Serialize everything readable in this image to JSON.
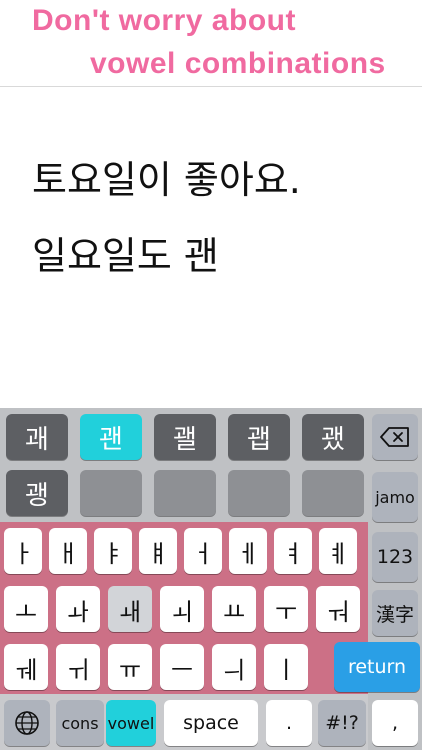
{
  "banner": {
    "line1": "Don't worry about",
    "line2": "vowel combinations",
    "color": "#f06aa0"
  },
  "editor": {
    "lines": [
      "토요일이 좋아요.",
      "일요일도 괜"
    ]
  },
  "keyboard": {
    "candidates_row1": [
      "괘",
      "괜",
      "괠",
      "괩",
      "괬"
    ],
    "candidates_row2": [
      "괭",
      "",
      "",
      "",
      ""
    ],
    "selected_candidate": "괜",
    "vowel_rows": [
      [
        "ㅏ",
        "ㅐ",
        "ㅑ",
        "ㅒ",
        "ㅓ",
        "ㅔ",
        "ㅕ",
        "ㅖ"
      ],
      [
        "ㅗ",
        "ㅘ",
        "ㅙ",
        "ㅚ",
        "ㅛ",
        "ㅜ",
        "ㅝ"
      ],
      [
        "ㅞ",
        "ㅟ",
        "ㅠ",
        "ㅡ",
        "ㅢ",
        "ㅣ"
      ]
    ],
    "pressed_vowel": "ㅙ",
    "side_keys": {
      "backspace_icon": "backspace-icon",
      "jamo": "jamo",
      "numbers": "123",
      "hanja": "漢字",
      "return": "return"
    },
    "bottom_row": {
      "globe_icon": "globe-icon",
      "cons": "cons",
      "vowel": "vowel",
      "space": "space",
      "period": ".",
      "symbols": "#!?",
      "comma": ","
    },
    "colors": {
      "candidate": "#5d5f63",
      "selected": "#21d0db",
      "pink_panel": "#cc7086",
      "return": "#2a9fe6"
    }
  }
}
